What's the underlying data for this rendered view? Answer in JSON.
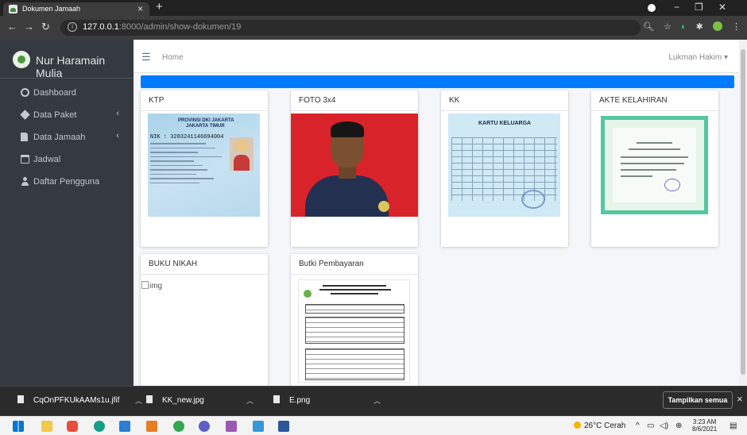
{
  "browser": {
    "tab_title": "Dokumen Jamaah",
    "tab_close": "×",
    "new_tab": "+",
    "url_host": "127.0.0.1",
    "url_port": ":8000",
    "url_path": "/admin/show-dokumen/19"
  },
  "sidebar": {
    "brand": "Nur Haramain Mulia",
    "items": [
      {
        "label": "Dashboard",
        "icon": "tachometer-icon"
      },
      {
        "label": "Data Paket",
        "icon": "box-icon",
        "arrow": "‹"
      },
      {
        "label": "Data Jamaah",
        "icon": "file-icon",
        "arrow": "‹"
      },
      {
        "label": "Jadwal",
        "icon": "calendar-icon"
      },
      {
        "label": "Daftar Pengguna",
        "icon": "user-icon"
      }
    ]
  },
  "navbar": {
    "home": "Home",
    "user": "Lukman Hakim ▾"
  },
  "documents": [
    {
      "title": "KTP"
    },
    {
      "title": "FOTO 3x4"
    },
    {
      "title": "KK"
    },
    {
      "title": "AKTE KELAHIRAN"
    },
    {
      "title": "BUKU NIKAH",
      "alt": "img"
    },
    {
      "title": "Butki Pembayaran"
    }
  ],
  "ktp": {
    "province": "PROVINSI DKI JAKARTA",
    "city": "JAKARTA TIMUR",
    "nik": "NIK  : 3203241146694004"
  },
  "kk": {
    "title": "KARTU KELUARGA"
  },
  "downloads": {
    "files": [
      "CqOnPFKUkAAMs1u.jfif",
      "KK_new.jpg",
      "E.png"
    ],
    "show_all": "Tampilkan semua",
    "close": "×"
  },
  "taskbar": {
    "weather": "26°C  Cerah",
    "time": "3:23 AM",
    "date": "8/6/2021"
  }
}
